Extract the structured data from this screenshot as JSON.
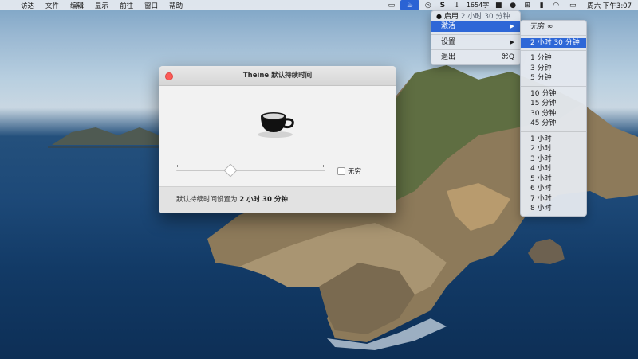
{
  "menubar": {
    "left_items": [
      "访达",
      "文件",
      "编辑",
      "显示",
      "前往",
      "窗口",
      "帮助"
    ],
    "word_count": "1654字",
    "clock": "周六 下午3:07"
  },
  "status_menu": {
    "header_label": "启用",
    "header_status": "2 小时 30 分钟",
    "activate": "激活",
    "settings": "设置",
    "quit": "退出",
    "quit_shortcut": "⌘Q"
  },
  "submenu": {
    "infinite": "无穷 ∞",
    "selected": "2 小时 30 分钟",
    "minutes_a": [
      "1 分钟",
      "3 分钟",
      "5 分钟"
    ],
    "minutes_b": [
      "10 分钟",
      "15 分钟",
      "30 分钟",
      "45 分钟"
    ],
    "hours": [
      "1 小时",
      "2 小时",
      "3 小时",
      "4 小时",
      "5 小时",
      "6 小时",
      "7 小时",
      "8 小时"
    ]
  },
  "window": {
    "title": "Theine 默认持续时间",
    "checkbox_label": "无穷",
    "footer_prefix": "默认持续时间设置为",
    "footer_value": "2 小时 30 分钟"
  }
}
